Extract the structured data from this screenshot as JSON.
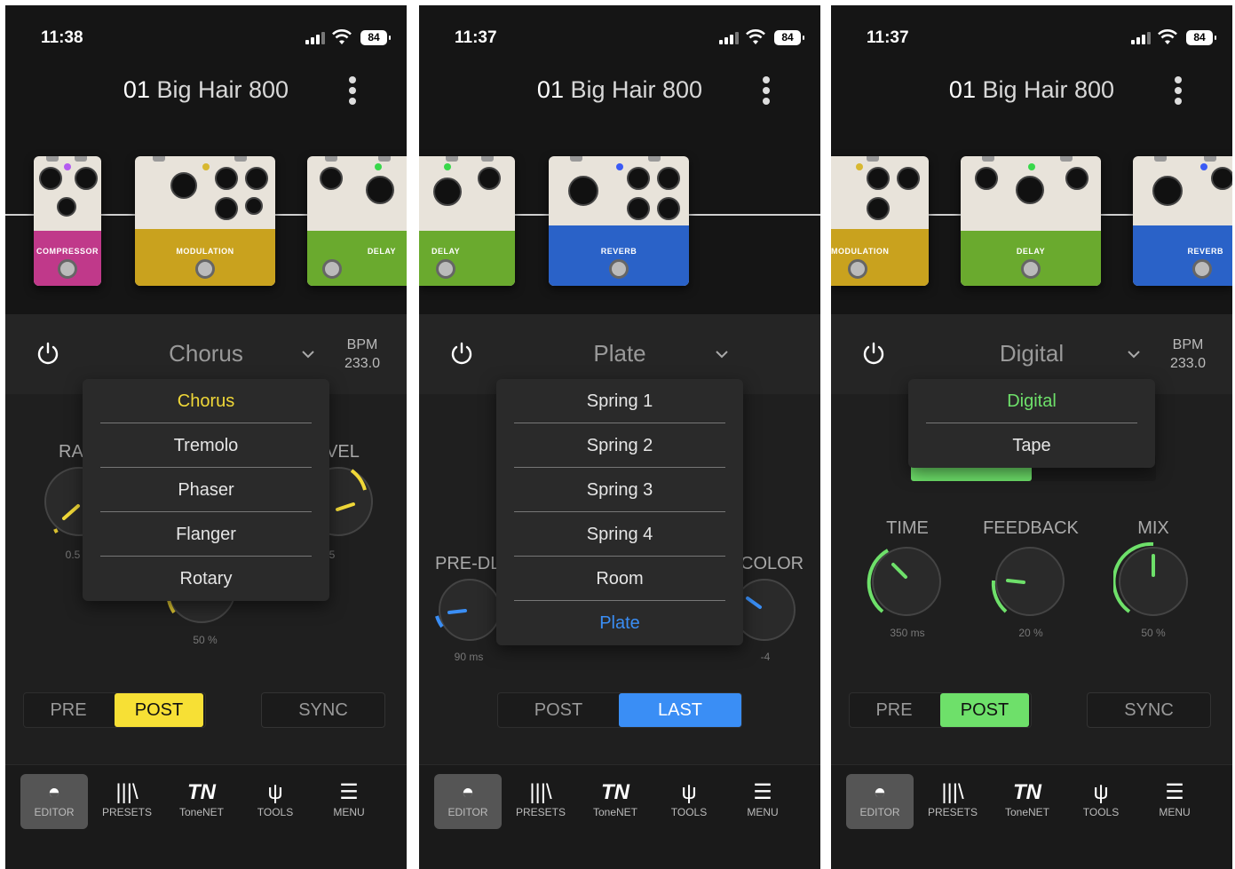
{
  "screens": [
    {
      "status": {
        "time": "11:38",
        "battery": "84"
      },
      "preset": {
        "number": "01",
        "name": "Big Hair 800"
      },
      "pedals": [
        "COMPRESSOR",
        "MODULATION",
        "DELAY"
      ],
      "effect_type": "Chorus",
      "bpm_label": "BPM",
      "bpm_value": "233.0",
      "dropdown": {
        "options": [
          "Chorus",
          "Tremolo",
          "Phaser",
          "Flanger",
          "Rotary"
        ],
        "selected": "Chorus",
        "accent": "#f0d838"
      },
      "knob_labels": {
        "left": "RA",
        "right": "VEL"
      },
      "knob_values": {
        "left": "0.5",
        "right": "5",
        "bottom": "50 %"
      },
      "routing": {
        "options": [
          "PRE",
          "POST"
        ],
        "selected": "POST",
        "color": "#f7e035"
      },
      "sync_label": "SYNC"
    },
    {
      "status": {
        "time": "11:37",
        "battery": "84"
      },
      "preset": {
        "number": "01",
        "name": "Big Hair 800"
      },
      "pedals": [
        "DELAY",
        "REVERB"
      ],
      "effect_type": "Plate",
      "dropdown": {
        "options": [
          "Spring 1",
          "Spring 2",
          "Spring 3",
          "Spring 4",
          "Room",
          "Plate"
        ],
        "selected": "Plate",
        "accent": "#3a8ef5"
      },
      "knob_labels": {
        "left": "PRE-DL",
        "right": "COLOR"
      },
      "knob_values": {
        "left": "90 ms",
        "right": "-4"
      },
      "routing": {
        "options": [
          "POST",
          "LAST"
        ],
        "selected": "LAST",
        "color": "#3a8ef5"
      }
    },
    {
      "status": {
        "time": "11:37",
        "battery": "84"
      },
      "preset": {
        "number": "01",
        "name": "Big Hair 800"
      },
      "pedals": [
        "MODULATION",
        "DELAY",
        "REVERB"
      ],
      "effect_type": "Digital",
      "bpm_label": "BPM",
      "bpm_value": "233.0",
      "dropdown": {
        "options": [
          "Digital",
          "Tape"
        ],
        "selected": "Digital",
        "accent": "#6ee06a"
      },
      "knob_labels": {
        "time": "TIME",
        "feedback": "FEEDBACK",
        "mix": "MIX"
      },
      "knob_values": {
        "time": "350 ms",
        "feedback": "20 %",
        "mix": "50 %"
      },
      "routing": {
        "options": [
          "PRE",
          "POST"
        ],
        "selected": "POST",
        "color": "#6ee06a"
      },
      "sync_label": "SYNC"
    }
  ],
  "nav": [
    {
      "label": "EDITOR",
      "icon": "editor-icon"
    },
    {
      "label": "PRESETS",
      "icon": "presets-icon"
    },
    {
      "label": "ToneNET",
      "icon": "tonenet-icon"
    },
    {
      "label": "TOOLS",
      "icon": "tools-icon"
    },
    {
      "label": "MENU",
      "icon": "menu-icon"
    }
  ],
  "nav_active": "EDITOR"
}
